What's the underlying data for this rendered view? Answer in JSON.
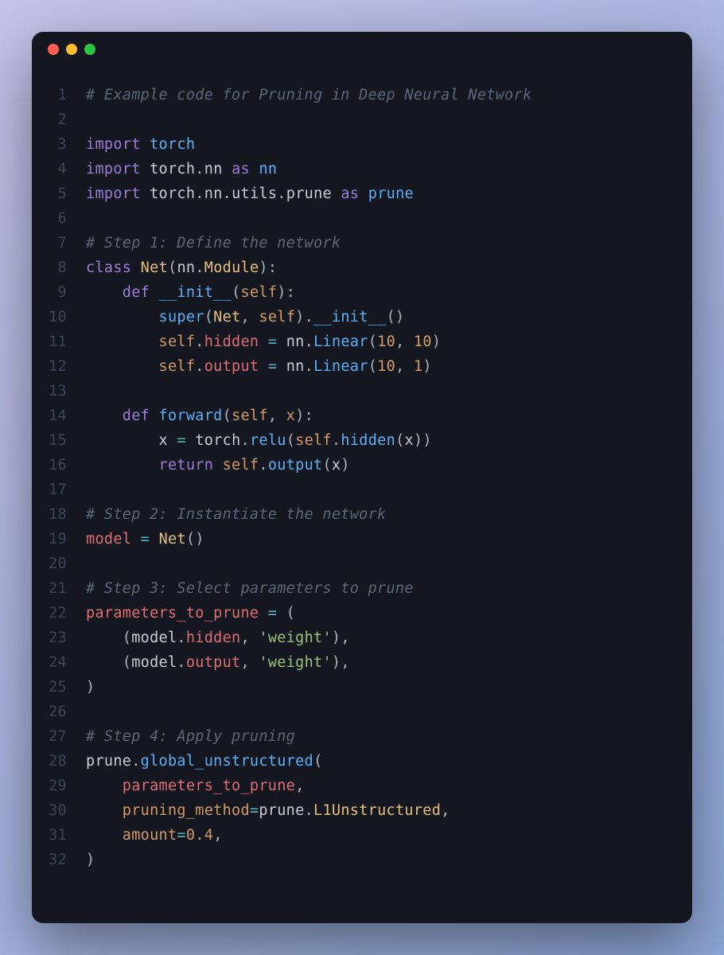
{
  "window": {
    "dots": [
      "red",
      "yellow",
      "green"
    ]
  },
  "colors": {
    "background_gradient_start": "#c8c2e8",
    "background_gradient_end": "#8fa8d8",
    "editor_bg": "#14171f",
    "gutter": "#3d4455",
    "comment": "#5c6678",
    "keyword": "#9d7cd8",
    "builtin": "#5ab0f6",
    "classname": "#e5c07b",
    "param": "#d19a66",
    "string": "#98c379",
    "attr": "#e06c75",
    "op": "#56b6c2"
  },
  "code": {
    "lines": [
      {
        "n": 1,
        "tokens": [
          {
            "t": "# Example code for Pruning in Deep Neural Network",
            "c": "comment"
          }
        ]
      },
      {
        "n": 2,
        "tokens": []
      },
      {
        "n": 3,
        "tokens": [
          {
            "t": "import",
            "c": "import-kw"
          },
          {
            "t": " ",
            "c": "mod"
          },
          {
            "t": "torch",
            "c": "builtin"
          }
        ]
      },
      {
        "n": 4,
        "tokens": [
          {
            "t": "import",
            "c": "import-kw"
          },
          {
            "t": " ",
            "c": "mod"
          },
          {
            "t": "torch",
            "c": "mod"
          },
          {
            "t": ".",
            "c": "punct"
          },
          {
            "t": "nn",
            "c": "mod"
          },
          {
            "t": " ",
            "c": "mod"
          },
          {
            "t": "as",
            "c": "as-kw"
          },
          {
            "t": " ",
            "c": "mod"
          },
          {
            "t": "nn",
            "c": "builtin"
          }
        ]
      },
      {
        "n": 5,
        "tokens": [
          {
            "t": "import",
            "c": "import-kw"
          },
          {
            "t": " ",
            "c": "mod"
          },
          {
            "t": "torch",
            "c": "mod"
          },
          {
            "t": ".",
            "c": "punct"
          },
          {
            "t": "nn",
            "c": "mod"
          },
          {
            "t": ".",
            "c": "punct"
          },
          {
            "t": "utils",
            "c": "mod"
          },
          {
            "t": ".",
            "c": "punct"
          },
          {
            "t": "prune",
            "c": "mod"
          },
          {
            "t": " ",
            "c": "mod"
          },
          {
            "t": "as",
            "c": "as-kw"
          },
          {
            "t": " ",
            "c": "mod"
          },
          {
            "t": "prune",
            "c": "builtin"
          }
        ]
      },
      {
        "n": 6,
        "tokens": []
      },
      {
        "n": 7,
        "tokens": [
          {
            "t": "# Step 1: Define the network",
            "c": "comment"
          }
        ]
      },
      {
        "n": 8,
        "tokens": [
          {
            "t": "class",
            "c": "keyword"
          },
          {
            "t": " ",
            "c": "mod"
          },
          {
            "t": "Net",
            "c": "classname"
          },
          {
            "t": "(",
            "c": "punct"
          },
          {
            "t": "nn",
            "c": "mod"
          },
          {
            "t": ".",
            "c": "punct"
          },
          {
            "t": "Module",
            "c": "classname"
          },
          {
            "t": "):",
            "c": "punct"
          }
        ]
      },
      {
        "n": 9,
        "tokens": [
          {
            "t": "    ",
            "c": "mod"
          },
          {
            "t": "def",
            "c": "def-kw"
          },
          {
            "t": " ",
            "c": "mod"
          },
          {
            "t": "__init__",
            "c": "funcname"
          },
          {
            "t": "(",
            "c": "punct"
          },
          {
            "t": "self",
            "c": "self"
          },
          {
            "t": "):",
            "c": "punct"
          }
        ]
      },
      {
        "n": 10,
        "tokens": [
          {
            "t": "        ",
            "c": "mod"
          },
          {
            "t": "super",
            "c": "builtin"
          },
          {
            "t": "(",
            "c": "punct"
          },
          {
            "t": "Net",
            "c": "classname"
          },
          {
            "t": ", ",
            "c": "punct"
          },
          {
            "t": "self",
            "c": "self"
          },
          {
            "t": ").",
            "c": "punct"
          },
          {
            "t": "__init__",
            "c": "funcname"
          },
          {
            "t": "()",
            "c": "punct"
          }
        ]
      },
      {
        "n": 11,
        "tokens": [
          {
            "t": "        ",
            "c": "mod"
          },
          {
            "t": "self",
            "c": "self"
          },
          {
            "t": ".",
            "c": "punct"
          },
          {
            "t": "hidden",
            "c": "attr"
          },
          {
            "t": " ",
            "c": "mod"
          },
          {
            "t": "=",
            "c": "op"
          },
          {
            "t": " ",
            "c": "mod"
          },
          {
            "t": "nn",
            "c": "mod"
          },
          {
            "t": ".",
            "c": "punct"
          },
          {
            "t": "Linear",
            "c": "call"
          },
          {
            "t": "(",
            "c": "punct"
          },
          {
            "t": "10",
            "c": "number"
          },
          {
            "t": ", ",
            "c": "punct"
          },
          {
            "t": "10",
            "c": "number"
          },
          {
            "t": ")",
            "c": "punct"
          }
        ]
      },
      {
        "n": 12,
        "tokens": [
          {
            "t": "        ",
            "c": "mod"
          },
          {
            "t": "self",
            "c": "self"
          },
          {
            "t": ".",
            "c": "punct"
          },
          {
            "t": "output",
            "c": "attr"
          },
          {
            "t": " ",
            "c": "mod"
          },
          {
            "t": "=",
            "c": "op"
          },
          {
            "t": " ",
            "c": "mod"
          },
          {
            "t": "nn",
            "c": "mod"
          },
          {
            "t": ".",
            "c": "punct"
          },
          {
            "t": "Linear",
            "c": "call"
          },
          {
            "t": "(",
            "c": "punct"
          },
          {
            "t": "10",
            "c": "number"
          },
          {
            "t": ", ",
            "c": "punct"
          },
          {
            "t": "1",
            "c": "number"
          },
          {
            "t": ")",
            "c": "punct"
          }
        ]
      },
      {
        "n": 13,
        "tokens": []
      },
      {
        "n": 14,
        "tokens": [
          {
            "t": "    ",
            "c": "mod"
          },
          {
            "t": "def",
            "c": "def-kw"
          },
          {
            "t": " ",
            "c": "mod"
          },
          {
            "t": "forward",
            "c": "funcname"
          },
          {
            "t": "(",
            "c": "punct"
          },
          {
            "t": "self",
            "c": "self"
          },
          {
            "t": ", ",
            "c": "punct"
          },
          {
            "t": "x",
            "c": "param"
          },
          {
            "t": "):",
            "c": "punct"
          }
        ]
      },
      {
        "n": 15,
        "tokens": [
          {
            "t": "        ",
            "c": "mod"
          },
          {
            "t": "x",
            "c": "mod"
          },
          {
            "t": " ",
            "c": "mod"
          },
          {
            "t": "=",
            "c": "op"
          },
          {
            "t": " ",
            "c": "mod"
          },
          {
            "t": "torch",
            "c": "mod"
          },
          {
            "t": ".",
            "c": "punct"
          },
          {
            "t": "relu",
            "c": "call"
          },
          {
            "t": "(",
            "c": "punct"
          },
          {
            "t": "self",
            "c": "self"
          },
          {
            "t": ".",
            "c": "punct"
          },
          {
            "t": "hidden",
            "c": "call"
          },
          {
            "t": "(",
            "c": "punct"
          },
          {
            "t": "x",
            "c": "mod"
          },
          {
            "t": "))",
            "c": "punct"
          }
        ]
      },
      {
        "n": 16,
        "tokens": [
          {
            "t": "        ",
            "c": "mod"
          },
          {
            "t": "return",
            "c": "keyword"
          },
          {
            "t": " ",
            "c": "mod"
          },
          {
            "t": "self",
            "c": "self"
          },
          {
            "t": ".",
            "c": "punct"
          },
          {
            "t": "output",
            "c": "call"
          },
          {
            "t": "(",
            "c": "punct"
          },
          {
            "t": "x",
            "c": "mod"
          },
          {
            "t": ")",
            "c": "punct"
          }
        ]
      },
      {
        "n": 17,
        "tokens": []
      },
      {
        "n": 18,
        "tokens": [
          {
            "t": "# Step 2: Instantiate the network",
            "c": "comment"
          }
        ]
      },
      {
        "n": 19,
        "tokens": [
          {
            "t": "model",
            "c": "var"
          },
          {
            "t": " ",
            "c": "mod"
          },
          {
            "t": "=",
            "c": "op"
          },
          {
            "t": " ",
            "c": "mod"
          },
          {
            "t": "Net",
            "c": "classname"
          },
          {
            "t": "()",
            "c": "punct"
          }
        ]
      },
      {
        "n": 20,
        "tokens": []
      },
      {
        "n": 21,
        "tokens": [
          {
            "t": "# Step 3: Select parameters to prune",
            "c": "comment"
          }
        ]
      },
      {
        "n": 22,
        "tokens": [
          {
            "t": "parameters_to_prune",
            "c": "var"
          },
          {
            "t": " ",
            "c": "mod"
          },
          {
            "t": "=",
            "c": "op"
          },
          {
            "t": " (",
            "c": "punct"
          }
        ]
      },
      {
        "n": 23,
        "tokens": [
          {
            "t": "    (",
            "c": "punct"
          },
          {
            "t": "model",
            "c": "mod"
          },
          {
            "t": ".",
            "c": "punct"
          },
          {
            "t": "hidden",
            "c": "attr"
          },
          {
            "t": ", ",
            "c": "punct"
          },
          {
            "t": "'weight'",
            "c": "string"
          },
          {
            "t": "),",
            "c": "punct"
          }
        ]
      },
      {
        "n": 24,
        "tokens": [
          {
            "t": "    (",
            "c": "punct"
          },
          {
            "t": "model",
            "c": "mod"
          },
          {
            "t": ".",
            "c": "punct"
          },
          {
            "t": "output",
            "c": "attr"
          },
          {
            "t": ", ",
            "c": "punct"
          },
          {
            "t": "'weight'",
            "c": "string"
          },
          {
            "t": "),",
            "c": "punct"
          }
        ]
      },
      {
        "n": 25,
        "tokens": [
          {
            "t": ")",
            "c": "punct"
          }
        ]
      },
      {
        "n": 26,
        "tokens": []
      },
      {
        "n": 27,
        "tokens": [
          {
            "t": "# Step 4: Apply pruning",
            "c": "comment"
          }
        ]
      },
      {
        "n": 28,
        "tokens": [
          {
            "t": "prune",
            "c": "mod"
          },
          {
            "t": ".",
            "c": "punct"
          },
          {
            "t": "global_unstructured",
            "c": "call"
          },
          {
            "t": "(",
            "c": "punct"
          }
        ]
      },
      {
        "n": 29,
        "tokens": [
          {
            "t": "    ",
            "c": "mod"
          },
          {
            "t": "parameters_to_prune",
            "c": "var"
          },
          {
            "t": ",",
            "c": "punct"
          }
        ]
      },
      {
        "n": 30,
        "tokens": [
          {
            "t": "    ",
            "c": "mod"
          },
          {
            "t": "pruning_method",
            "c": "param"
          },
          {
            "t": "=",
            "c": "op"
          },
          {
            "t": "prune",
            "c": "mod"
          },
          {
            "t": ".",
            "c": "punct"
          },
          {
            "t": "L1Unstructured",
            "c": "classname"
          },
          {
            "t": ",",
            "c": "punct"
          }
        ]
      },
      {
        "n": 31,
        "tokens": [
          {
            "t": "    ",
            "c": "mod"
          },
          {
            "t": "amount",
            "c": "param"
          },
          {
            "t": "=",
            "c": "op"
          },
          {
            "t": "0.4",
            "c": "number"
          },
          {
            "t": ",",
            "c": "punct"
          }
        ]
      },
      {
        "n": 32,
        "tokens": [
          {
            "t": ")",
            "c": "punct"
          }
        ]
      }
    ]
  }
}
